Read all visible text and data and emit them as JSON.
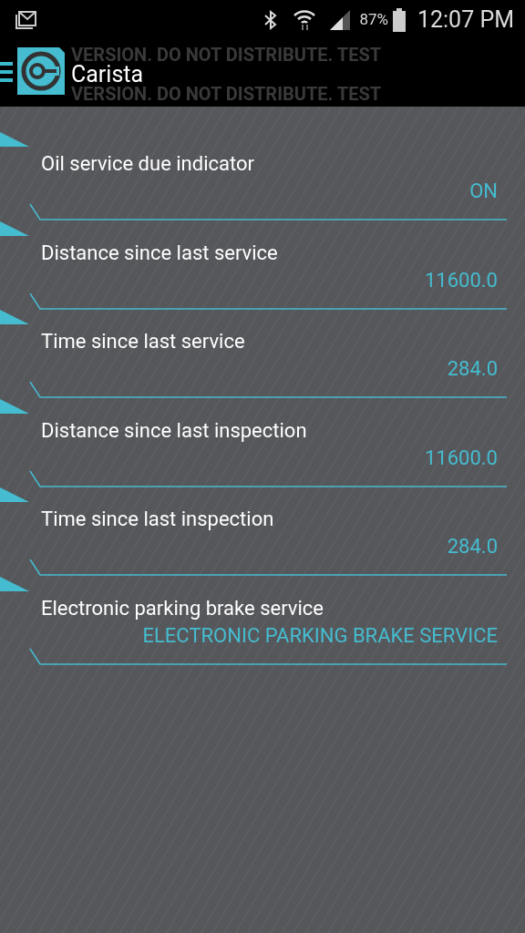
{
  "status_bar": {
    "battery": "87%",
    "time": "12:07 PM"
  },
  "app_bar": {
    "title": "Carista",
    "test_banner": [
      "VERSION. DO NOT DISTRIBUTE.  TEST",
      "VERSION. DO NOT DISTRIBUTE.  TEST"
    ]
  },
  "settings": [
    {
      "label": "Oil service due indicator",
      "value": "ON"
    },
    {
      "label": "Distance since last service",
      "value": "11600.0"
    },
    {
      "label": "Time since last service",
      "value": "284.0"
    },
    {
      "label": "Distance since last inspection",
      "value": "11600.0"
    },
    {
      "label": "Time since last inspection",
      "value": "284.0"
    },
    {
      "label": "Electronic parking brake service",
      "value": "ELECTRONIC PARKING BRAKE SERVICE"
    }
  ]
}
